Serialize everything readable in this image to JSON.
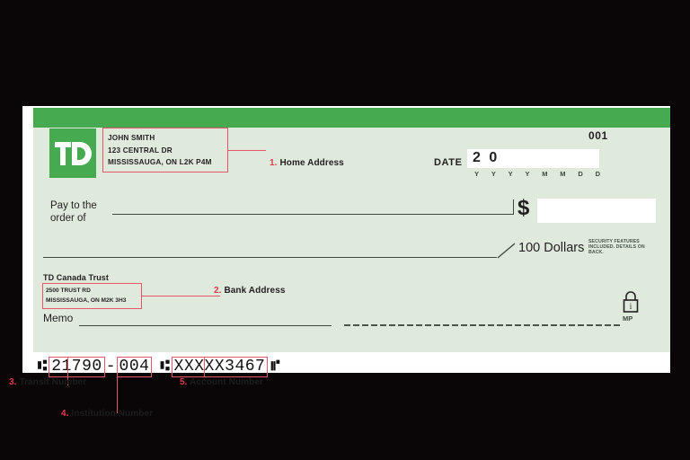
{
  "cheque": {
    "number": "001",
    "logo_text": "TD",
    "home_address": [
      "JOHN SMITH",
      "123 CENTRAL DR",
      "MISSISSAUGA, ON L2K P4M"
    ],
    "date_label": "DATE",
    "date_value": "2 0",
    "date_format": [
      "Y",
      "Y",
      "Y",
      "Y",
      "M",
      "M",
      "D",
      "D"
    ],
    "pay_to_label_line1": "Pay to the",
    "pay_to_label_line2": "order of",
    "pay_to_value": "",
    "currency_symbol": "$",
    "amount_value": "",
    "written_amount": "100 Dollars",
    "security_notice": "SECURITY FEATURES INCLUDED. DETAILS ON BACK.",
    "bank_name": "TD Canada Trust",
    "bank_address": [
      "2500 TRUST RD",
      "MISSISSAUGA, ON M2K 3H3"
    ],
    "memo_label": "Memo",
    "memo_value": "",
    "lock_label": "MP",
    "micr": {
      "transit_number": "21790",
      "separator": "-",
      "institution_number": "004",
      "account_number": "XXXXX3467"
    }
  },
  "callouts": [
    {
      "num": "1.",
      "label": "Home Address"
    },
    {
      "num": "2.",
      "label": "Bank Address"
    },
    {
      "num": "3.",
      "label": "Transit Number"
    },
    {
      "num": "4.",
      "label": "Institution Number"
    },
    {
      "num": "5.",
      "label": "Account Number"
    }
  ],
  "colors": {
    "td_green": "#46ab50",
    "cheque_bg": "#dfeadd",
    "callout_red": "#e8566b",
    "number_red": "#e03a50",
    "background": "#0a0607"
  }
}
